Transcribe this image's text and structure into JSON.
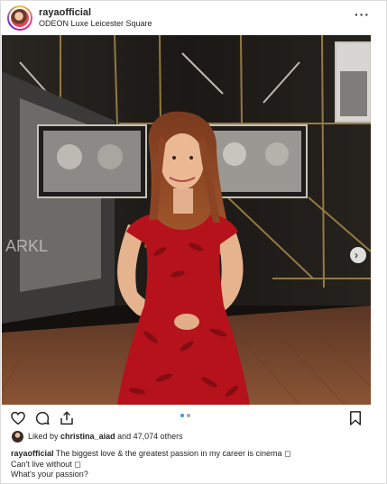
{
  "header": {
    "username": "rayaofficial",
    "location": "ODEON Luxe Leicester Square",
    "more_icon": "more-horizontal-icon"
  },
  "photo": {
    "icon_next": "chevron-right-icon",
    "carousel_count": 2,
    "carousel_active": 1
  },
  "actions": {
    "like_icon": "heart-icon",
    "comment_icon": "comment-icon",
    "share_icon": "share-icon",
    "save_icon": "bookmark-icon"
  },
  "likes": {
    "prefix": "Liked by",
    "user": "christina_aiad",
    "suffix": "and 47,074 others"
  },
  "caption": {
    "username": "rayaofficial",
    "text": "The biggest love & the greatest passion in my career is cinema ◻",
    "line2": "Can't live without ◻",
    "line3": "What's your passion?"
  },
  "colors": {
    "dress": "#b5121b",
    "text": "#262626",
    "border": "#dbdbdb"
  }
}
